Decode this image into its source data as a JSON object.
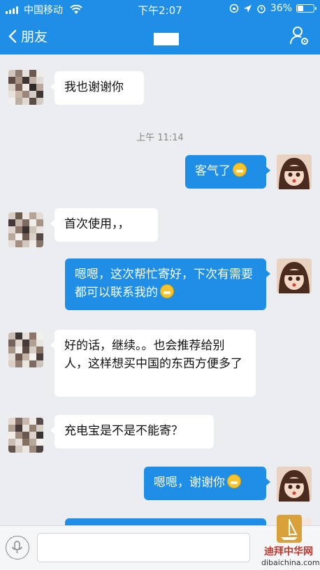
{
  "status_bar": {
    "carrier": "中国移动",
    "time": "下午2:07",
    "battery": "36%",
    "battery_level": 0.36
  },
  "nav": {
    "back_label": "朋友"
  },
  "messages": [
    {
      "side": "in",
      "text": "我也谢谢你"
    },
    {
      "type": "time",
      "text": "上午 11:14"
    },
    {
      "side": "out",
      "text": "客气了",
      "emoji": "grin-emoji"
    },
    {
      "side": "in",
      "text": "首次使用，，"
    },
    {
      "side": "out",
      "text": "嗯嗯，这次帮忙寄好，下次有需要都可以联系我的",
      "emoji": "thinking-emoji"
    },
    {
      "side": "in",
      "text": "好的话，继续。。也会推荐给别人，这样想买中国的东西方便多了"
    },
    {
      "side": "in",
      "text": "充电宝是不是不能寄？"
    },
    {
      "side": "out",
      "text": "嗯嗯，谢谢你",
      "emoji": "wink-emoji"
    }
  ],
  "watermark": {
    "name": "迪拜中华网",
    "url": "dibaichina.com"
  },
  "colors": {
    "accent": "#1e8ee7",
    "background": "#ebedf0"
  }
}
